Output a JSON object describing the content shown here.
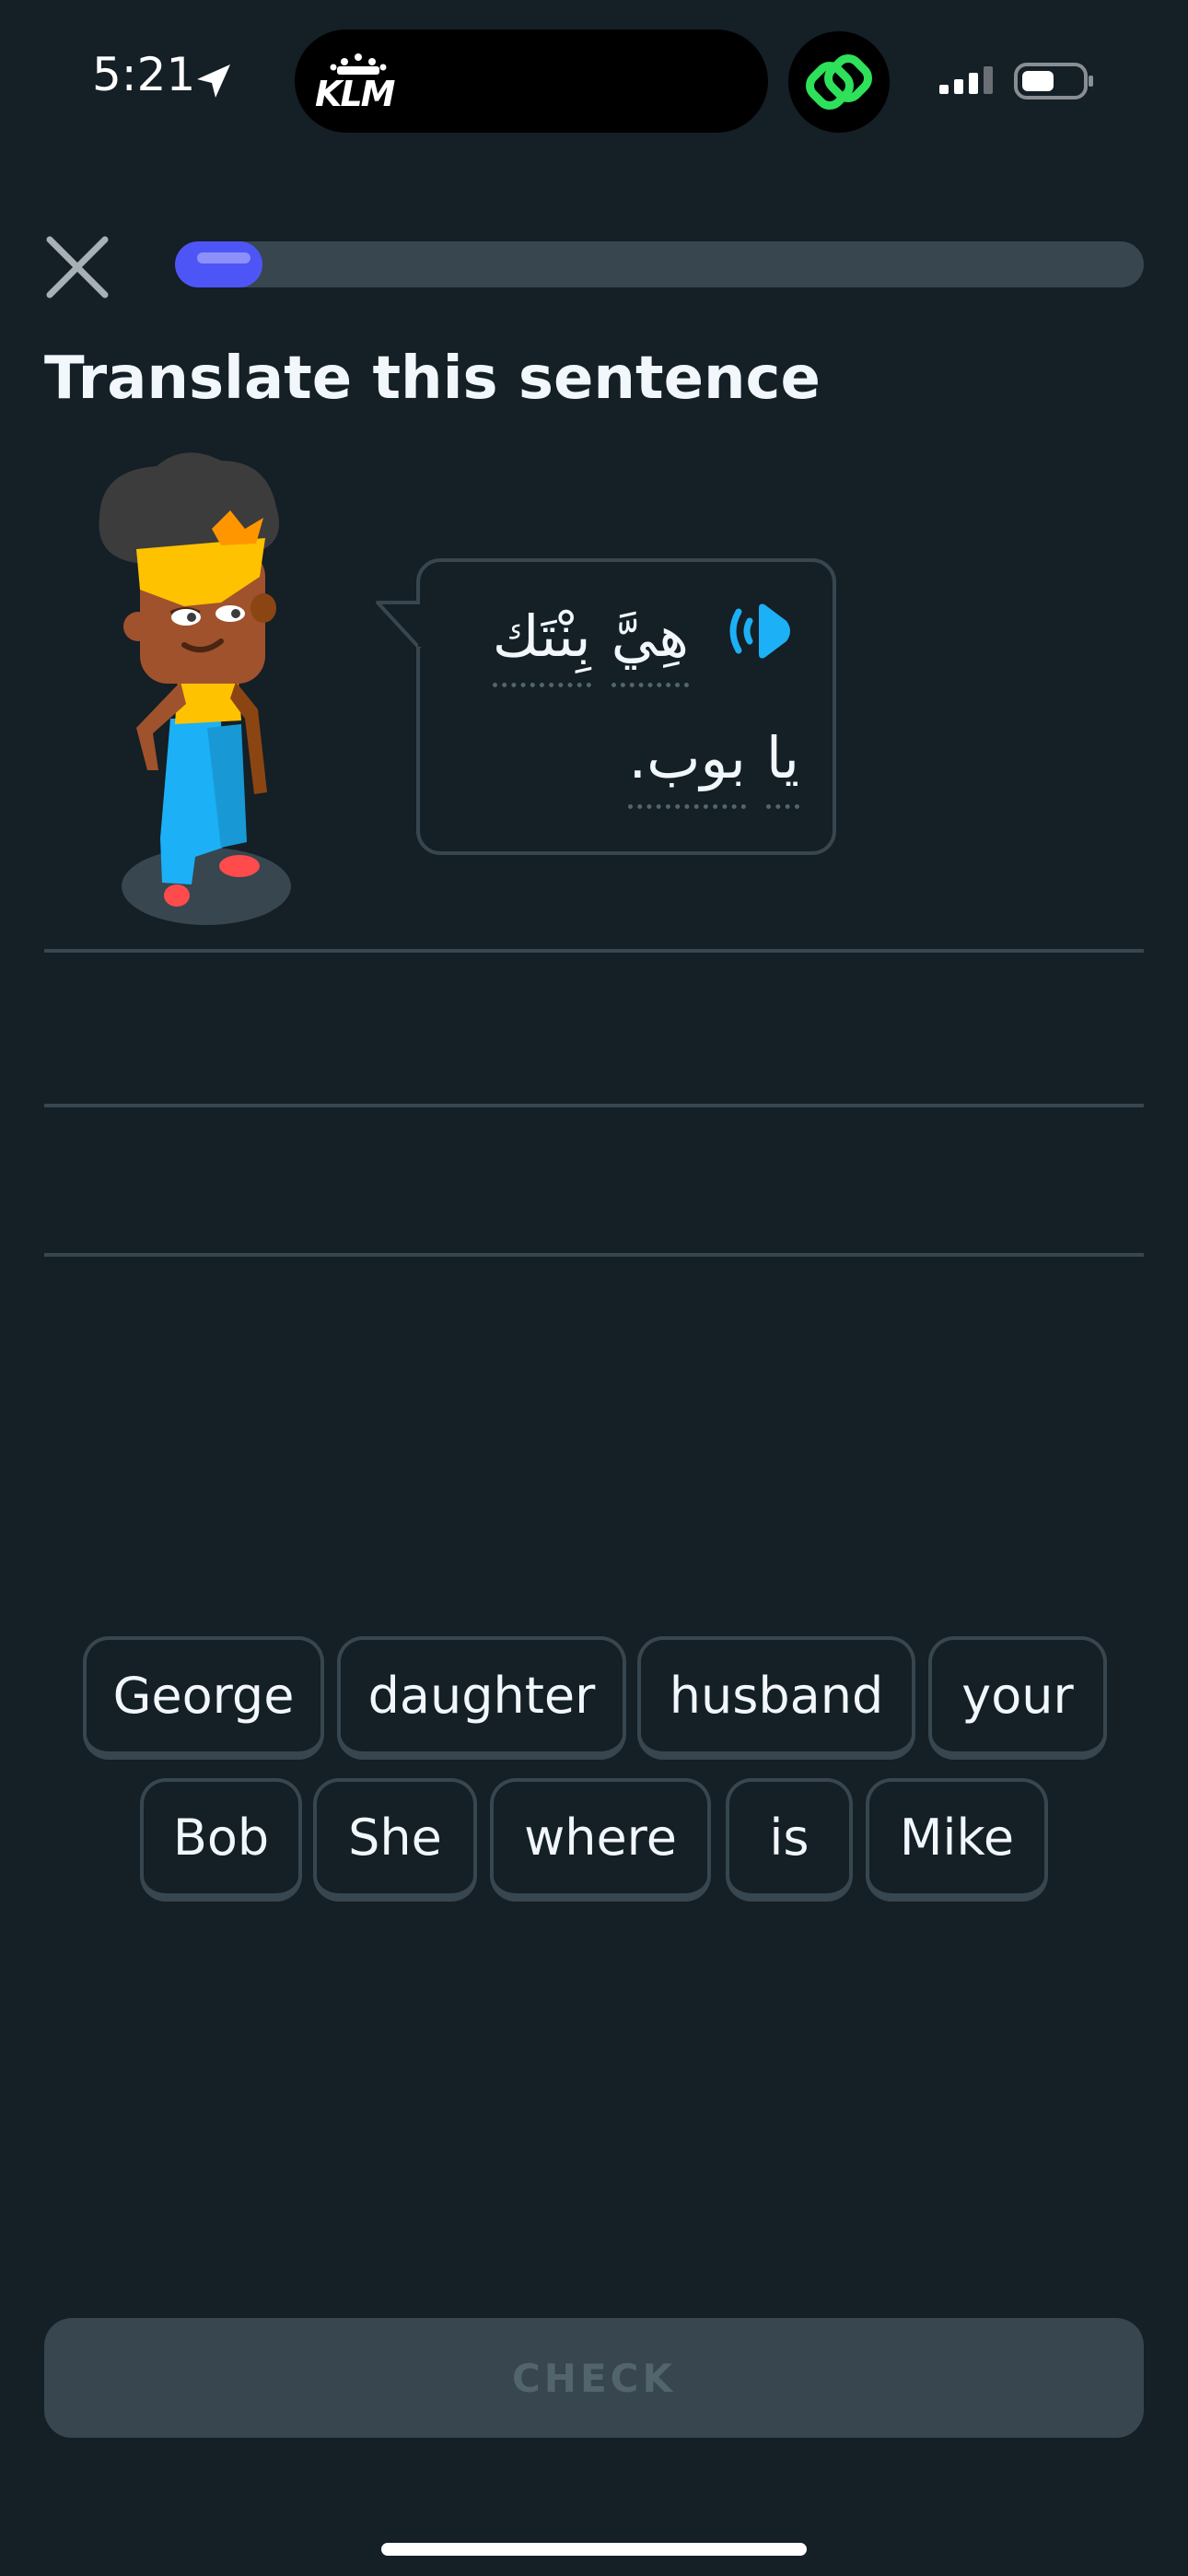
{
  "status_bar": {
    "time": "5:21",
    "island_logo_text": "KLM"
  },
  "header": {
    "progress_fraction": 0.09
  },
  "prompt": {
    "title": "Translate this sentence"
  },
  "bubble": {
    "line1_words": [
      "هِيَّ",
      "بِنْتَك"
    ],
    "line2_words": [
      "يا",
      "بوب."
    ]
  },
  "word_bank": [
    [
      "George",
      "daughter",
      "husband",
      "your"
    ],
    [
      "Bob",
      "She",
      "where",
      "is",
      "Mike"
    ]
  ],
  "footer": {
    "check_label": "CHECK"
  },
  "colors": {
    "background": "#141f26",
    "border": "#37464f",
    "progress": "#4e55f7",
    "speaker": "#1cb0f6",
    "text": "#f1f7fb",
    "disabled_text": "#52656d"
  }
}
